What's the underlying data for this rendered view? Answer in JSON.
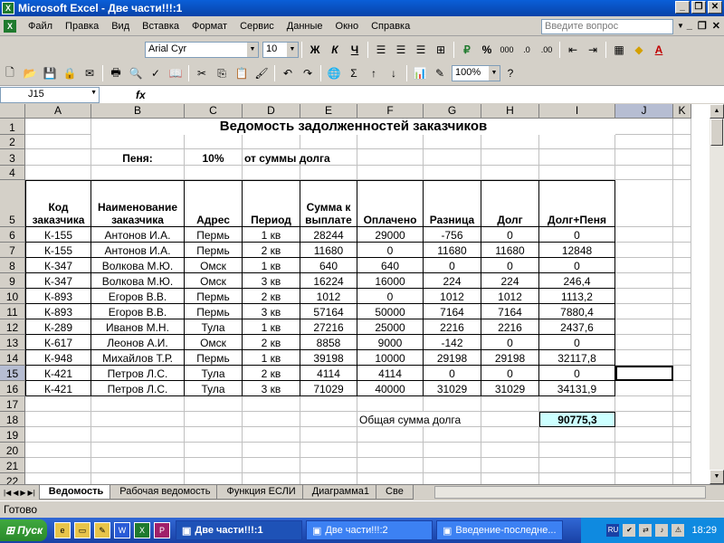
{
  "window": {
    "title": "Microsoft Excel - Две части!!!:1",
    "icon": "excel-icon"
  },
  "menu": {
    "items": [
      "Файл",
      "Правка",
      "Вид",
      "Вставка",
      "Формат",
      "Сервис",
      "Данные",
      "Окно",
      "Справка"
    ],
    "help_placeholder": "Введите вопрос"
  },
  "toolbar": {
    "font": "Arial Cyr",
    "size": "10",
    "zoom": "100%",
    "bold": "Ж",
    "italic": "К",
    "underline": "Ч",
    "percent": "%",
    "thousands": "000"
  },
  "formula": {
    "cell_ref": "J15",
    "fx": "fx",
    "content": ""
  },
  "columns": [
    "A",
    "B",
    "C",
    "D",
    "E",
    "F",
    "G",
    "H",
    "I",
    "J",
    "K"
  ],
  "rows": [
    "1",
    "2",
    "3",
    "4",
    "5",
    "6",
    "7",
    "8",
    "9",
    "10",
    "11",
    "12",
    "13",
    "14",
    "15",
    "16",
    "17",
    "18",
    "19",
    "20",
    "21",
    "22"
  ],
  "sheet": {
    "title": "Ведомость задолженностей заказчиков",
    "penalty_label": "Пеня:",
    "penalty_value": "10%",
    "penalty_note": "от суммы долга",
    "headers": [
      "Код заказчика",
      "Наименование заказчика",
      "Адрес",
      "Период",
      "Сумма к выплате",
      "Оплачено",
      "Разница",
      "Долг",
      "Долг+Пеня"
    ],
    "data": [
      [
        "К-155",
        "Антонов И.А.",
        "Пермь",
        "1 кв",
        "28244",
        "29000",
        "-756",
        "0",
        "0"
      ],
      [
        "К-155",
        "Антонов И.А.",
        "Пермь",
        "2 кв",
        "11680",
        "0",
        "11680",
        "11680",
        "12848"
      ],
      [
        "К-347",
        "Волкова М.Ю.",
        "Омск",
        "1 кв",
        "640",
        "640",
        "0",
        "0",
        "0"
      ],
      [
        "К-347",
        "Волкова М.Ю.",
        "Омск",
        "3 кв",
        "16224",
        "16000",
        "224",
        "224",
        "246,4"
      ],
      [
        "К-893",
        "Егоров В.В.",
        "Пермь",
        "2 кв",
        "1012",
        "0",
        "1012",
        "1012",
        "1113,2"
      ],
      [
        "К-893",
        "Егоров В.В.",
        "Пермь",
        "3 кв",
        "57164",
        "50000",
        "7164",
        "7164",
        "7880,4"
      ],
      [
        "К-289",
        "Иванов М.Н.",
        "Тула",
        "1 кв",
        "27216",
        "25000",
        "2216",
        "2216",
        "2437,6"
      ],
      [
        "К-617",
        "Леонов А.И.",
        "Омск",
        "2 кв",
        "8858",
        "9000",
        "-142",
        "0",
        "0"
      ],
      [
        "К-948",
        "Михайлов Т.Р.",
        "Пермь",
        "1 кв",
        "39198",
        "10000",
        "29198",
        "29198",
        "32117,8"
      ],
      [
        "К-421",
        "Петров Л.С.",
        "Тула",
        "2 кв",
        "4114",
        "4114",
        "0",
        "0",
        "0"
      ],
      [
        "К-421",
        "Петров Л.С.",
        "Тула",
        "3 кв",
        "71029",
        "40000",
        "31029",
        "31029",
        "34131,9"
      ]
    ],
    "total_label": "Общая сумма долга",
    "total_value": "90775,3"
  },
  "tabs": [
    "Ведомость",
    "Рабочая ведомость",
    "Функция ЕСЛИ",
    "Диаграмма1",
    "Све"
  ],
  "status": "Готово",
  "taskbar": {
    "start": "Пуск",
    "buttons": [
      "Две части!!!:1",
      "Две части!!!:2",
      "Введение-последне..."
    ],
    "lang": "RU",
    "clock": "18:29"
  }
}
